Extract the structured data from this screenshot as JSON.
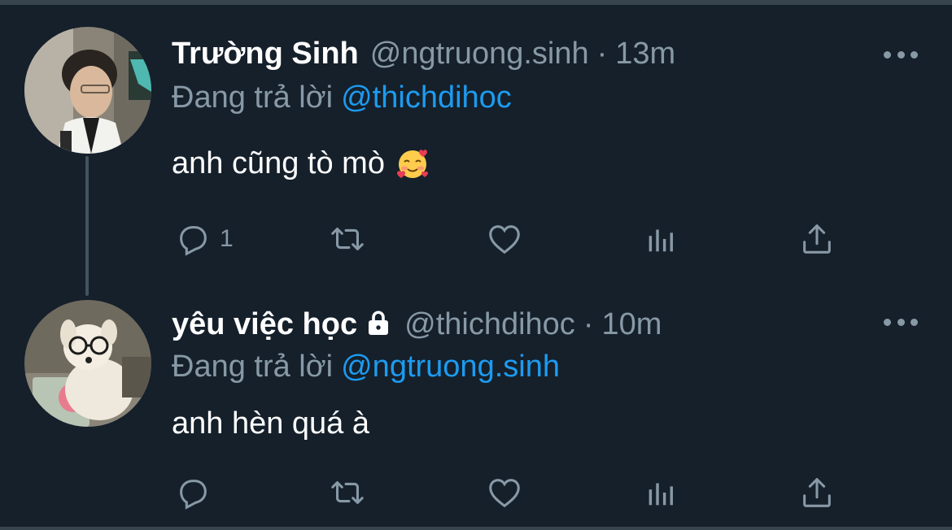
{
  "tweets": [
    {
      "display_name": "Trường Sinh",
      "handle": "@ngtruong.sinh",
      "separator": "·",
      "time": "13m",
      "protected": false,
      "reply_prefix": "Đang trả lời",
      "reply_to": "@thichdihoc",
      "text": "anh cũng tò mò",
      "emoji": "smiling-face-with-hearts",
      "reply_count": "1",
      "avatar": "person-photo"
    },
    {
      "display_name": "yêu việc học",
      "handle": "@thichdihoc",
      "separator": "·",
      "time": "10m",
      "protected": true,
      "reply_prefix": "Đang trả lời",
      "reply_to": "@ngtruong.sinh",
      "text": "anh hèn quá à",
      "reply_count": "",
      "avatar": "plush-dog-with-glasses-photo"
    }
  ],
  "colors": {
    "background": "#15202b",
    "text_primary": "#ffffff",
    "text_secondary": "#8899a6",
    "link": "#1d9bf0",
    "divider": "#38444d"
  }
}
